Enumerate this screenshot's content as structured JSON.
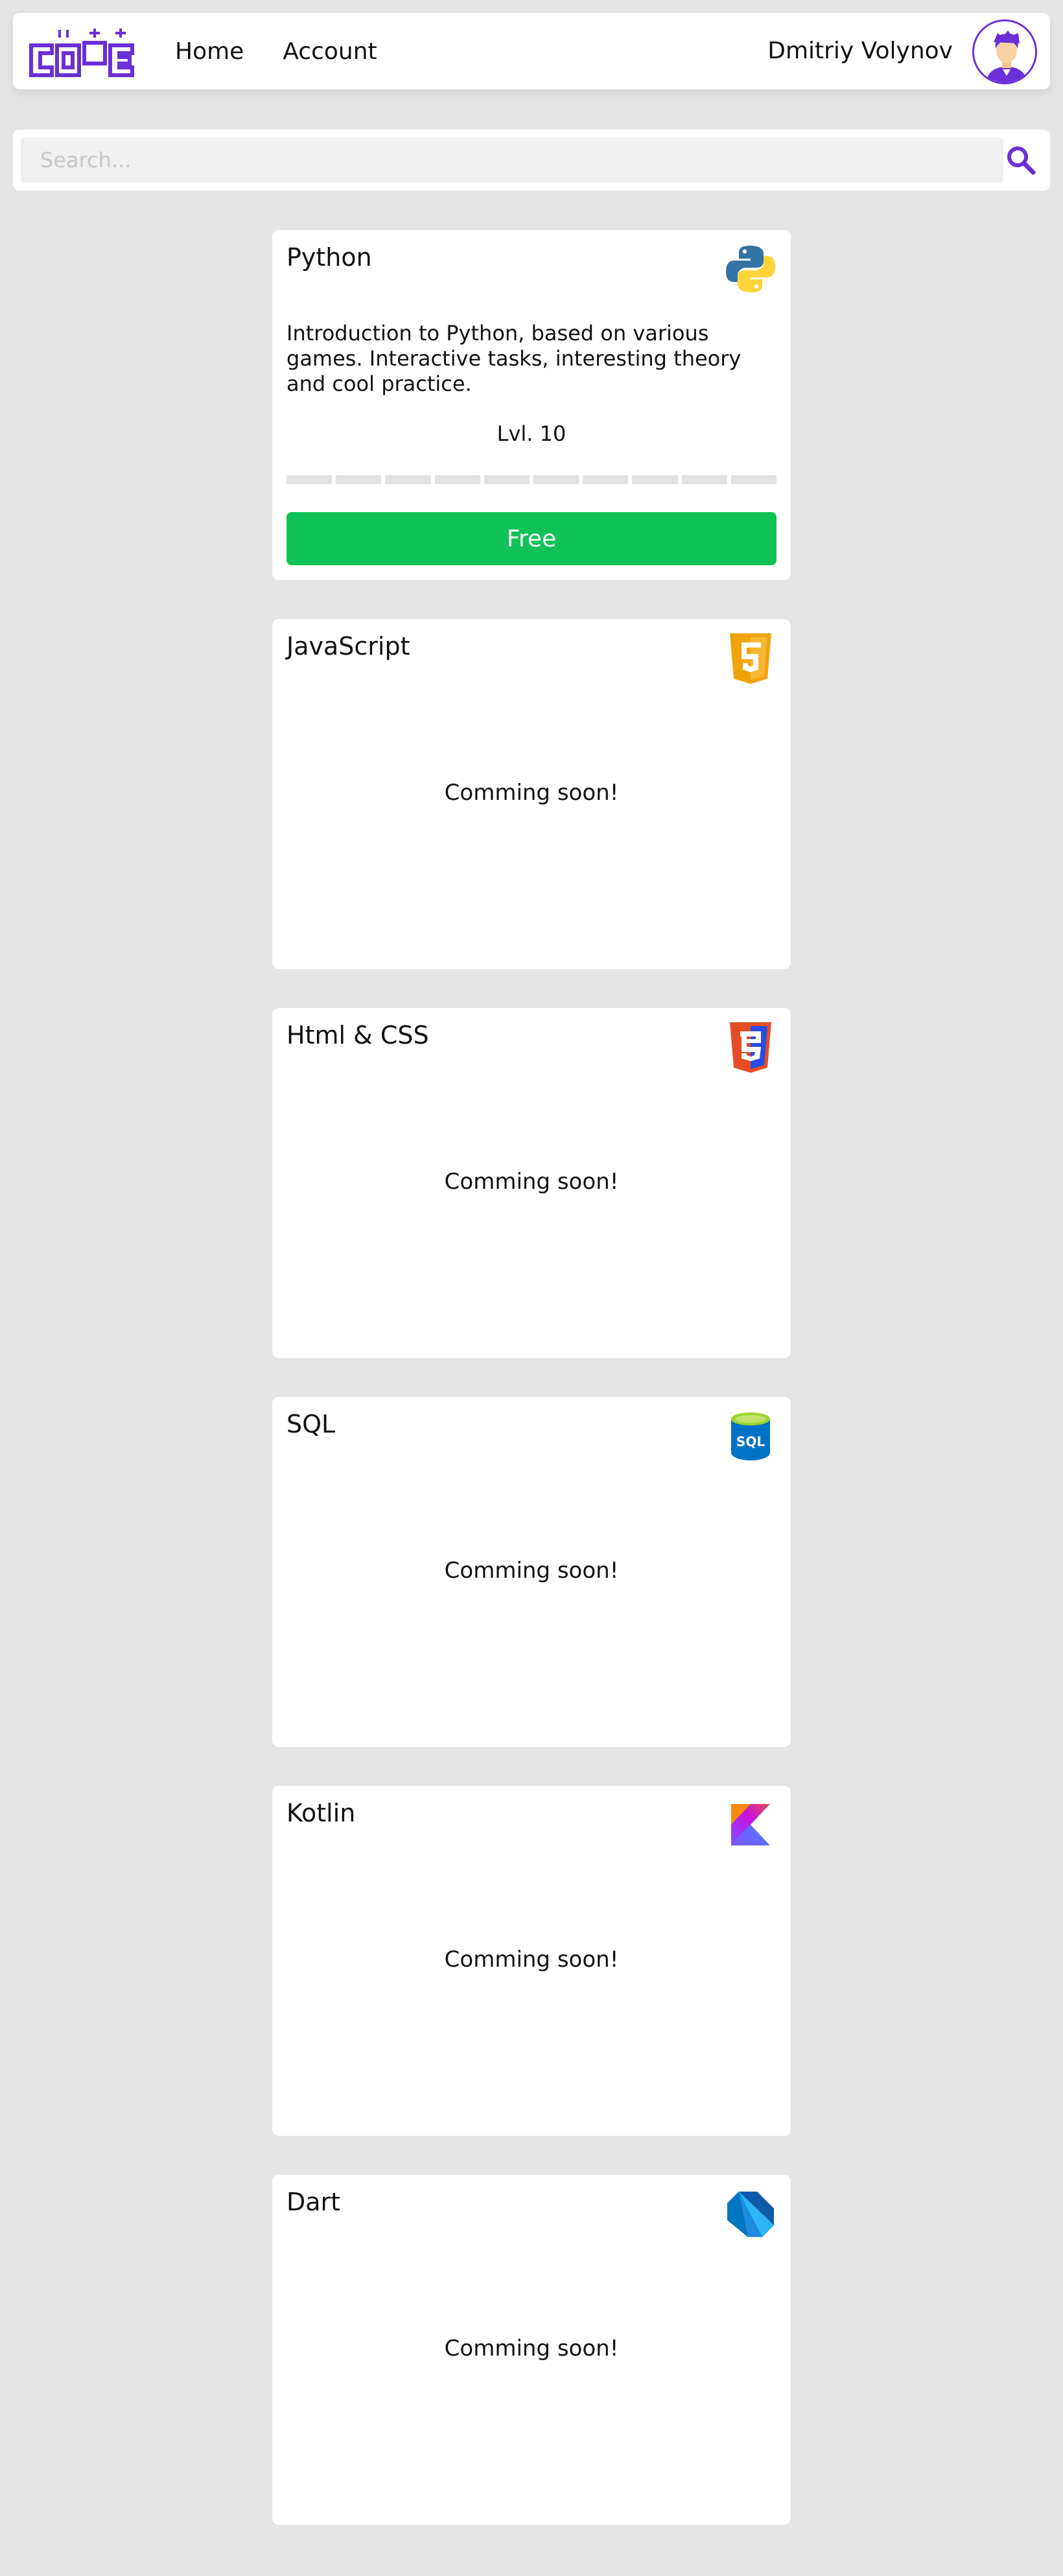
{
  "header": {
    "logo_text": "CODE",
    "nav": [
      {
        "label": "Home"
      },
      {
        "label": "Account"
      }
    ],
    "user_name": "Dmitriy Volynov"
  },
  "search": {
    "placeholder": "Search..."
  },
  "courses": [
    {
      "title": "Python",
      "icon": "python-icon",
      "description": "Introduction to Python, based on various games. Interactive tasks, interesting theory and cool practice.",
      "level": "Lvl. 10",
      "progress_filled": 0,
      "progress_total": 10,
      "button_label": "Free"
    },
    {
      "title": "JavaScript",
      "icon": "javascript-icon",
      "status": "Comming soon!"
    },
    {
      "title": "Html & CSS",
      "icon": "html-css-icon",
      "status": "Comming soon!"
    },
    {
      "title": "SQL",
      "icon": "sql-icon",
      "status": "Comming soon!"
    },
    {
      "title": "Kotlin",
      "icon": "kotlin-icon",
      "status": "Comming soon!"
    },
    {
      "title": "Dart",
      "icon": "dart-icon",
      "status": "Comming soon!"
    }
  ],
  "colors": {
    "accent": "#6a2fd6",
    "free_button": "#10c256",
    "background": "#e5e5e5"
  }
}
